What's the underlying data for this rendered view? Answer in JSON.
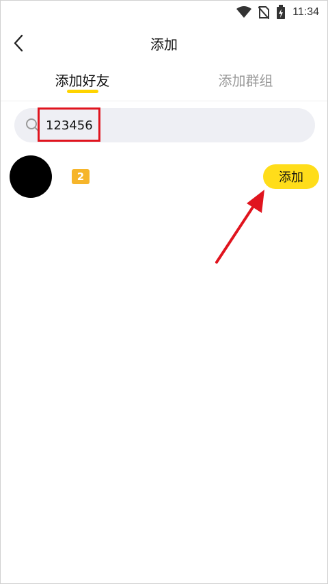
{
  "status_bar": {
    "time": "11:34",
    "icons": [
      "wifi-icon",
      "no-sim-icon",
      "battery-charging-icon"
    ]
  },
  "header": {
    "title": "添加"
  },
  "tabs": [
    {
      "label": "添加好友",
      "active": true
    },
    {
      "label": "添加群组",
      "active": false
    }
  ],
  "search": {
    "value": "123456"
  },
  "result": {
    "level": "2",
    "add_label": "添加"
  },
  "colors": {
    "accent": "#ffd400",
    "highlight": "#e0141e",
    "arrow": "#e0141e"
  }
}
